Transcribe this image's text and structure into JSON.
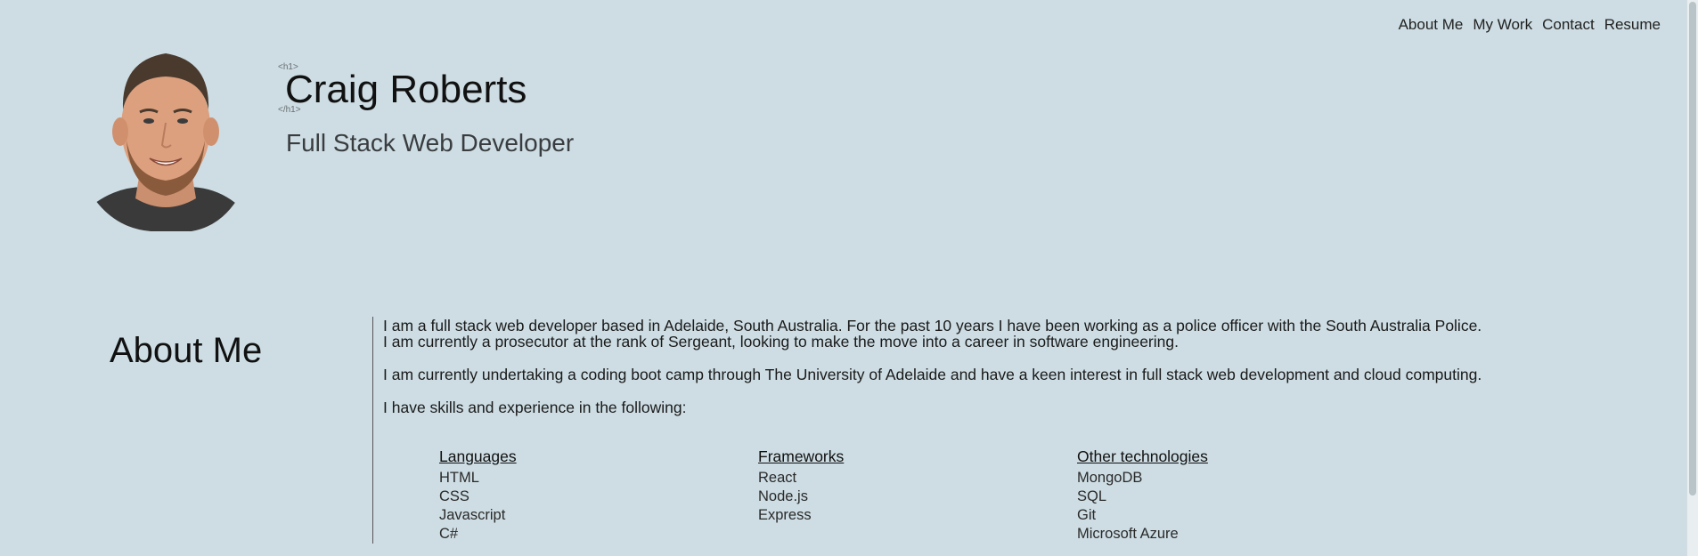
{
  "nav": {
    "items": [
      "About Me",
      "My Work",
      "Contact",
      "Resume"
    ]
  },
  "header": {
    "h1_open_tag": "<h1>",
    "h1_close_tag": "</h1>",
    "name": "Craig Roberts",
    "title": "Full Stack Web Developer"
  },
  "about": {
    "heading": "About Me",
    "paragraphs": [
      "I am a full stack web developer based in Adelaide, South Australia. For the past 10 years I have been working as a police officer with the South Australia Police. I am currently a prosecutor at the rank of Sergeant, looking to make the move into a career in software engineering.",
      "I am currently undertaking a coding boot camp through The University of Adelaide and have a keen interest in full stack web development and cloud computing.",
      "I have skills and experience in the following:"
    ],
    "skills": [
      {
        "heading": "Languages",
        "items": [
          "HTML",
          "CSS",
          "Javascript",
          "C#"
        ]
      },
      {
        "heading": "Frameworks",
        "items": [
          "React",
          "Node.js",
          "Express"
        ]
      },
      {
        "heading": "Other technologies",
        "items": [
          "MongoDB",
          "SQL",
          "Git",
          "Microsoft Azure"
        ]
      }
    ]
  },
  "colors": {
    "background": "#cddde3",
    "text": "#1a1a1a",
    "subtitle": "#3a3d40"
  }
}
